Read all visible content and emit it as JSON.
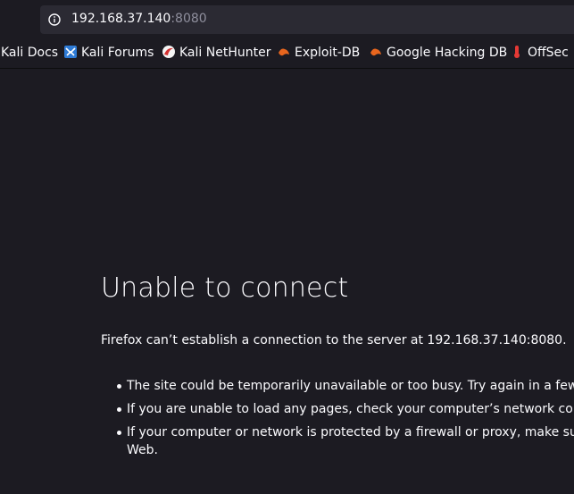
{
  "url": {
    "host": "192.168.37.140",
    "port": ":8080"
  },
  "bookmarks": [
    {
      "label": "Kali Docs",
      "icon": "kali-docs-icon"
    },
    {
      "label": "Kali Forums",
      "icon": "kali-forums-icon"
    },
    {
      "label": "Kali NetHunter",
      "icon": "kali-nethunter-icon"
    },
    {
      "label": "Exploit-DB",
      "icon": "exploit-db-icon"
    },
    {
      "label": "Google Hacking DB",
      "icon": "google-hacking-db-icon"
    },
    {
      "label": "OffSec",
      "icon": "offsec-icon"
    }
  ],
  "error": {
    "title": "Unable to connect",
    "description": "Firefox can’t establish a connection to the server at 192.168.37.140:8080.",
    "items": [
      "The site could be temporarily unavailable or too busy. Try again in a few mor",
      "If you are unable to load any pages, check your computer’s network connect",
      "If your computer or network is protected by a firewall or proxy, make sure th"
    ],
    "item3_continuation": "Web."
  },
  "colors": {
    "background": "#1c1b22",
    "urlbar": "#2b2a33",
    "text": "#fbfbfe",
    "port_text": "#8f8f9d"
  }
}
